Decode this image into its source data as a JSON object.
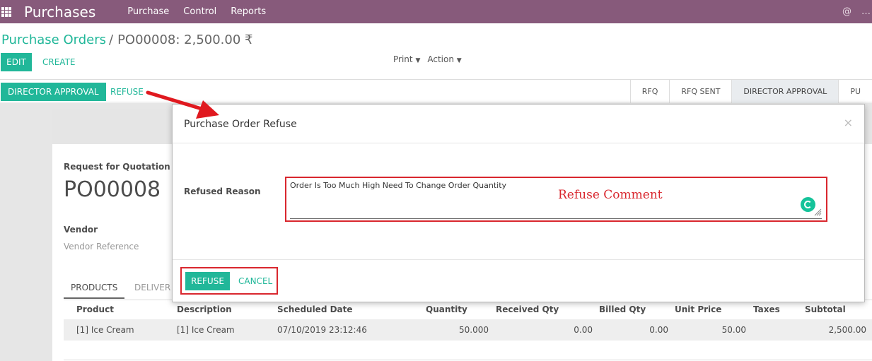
{
  "topbar": {
    "app_title": "Purchases",
    "menu": [
      "Purchase",
      "Control",
      "Reports"
    ],
    "right_icons": [
      "@",
      "…"
    ]
  },
  "breadcrumb": {
    "parent": "Purchase Orders",
    "separator": "/",
    "current": "PO00008: 2,500.00 ₹"
  },
  "control_panel": {
    "edit_label": "EDIT",
    "create_label": "CREATE",
    "print_label": "Print",
    "action_label": "Action"
  },
  "status_row": {
    "director_approval_label": "DIRECTOR APPROVAL",
    "refuse_label": "REFUSE",
    "stages": [
      "RFQ",
      "RFQ SENT",
      "DIRECTOR APPROVAL",
      "PU"
    ],
    "current_stage": "DIRECTOR APPROVAL"
  },
  "form": {
    "subtitle": "Request for Quotation",
    "po_number": "PO00008",
    "vendor_label": "Vendor",
    "vendor_reference_label": "Vendor Reference",
    "tab_products": "PRODUCTS",
    "tab_deliveries": "DELIVER"
  },
  "order_lines": {
    "headers": [
      "Product",
      "Description",
      "Scheduled Date",
      "Quantity",
      "Received Qty",
      "Billed Qty",
      "Unit Price",
      "Taxes",
      "Subtotal"
    ],
    "rows": [
      {
        "product": "[1] Ice Cream",
        "description": "[1] Ice Cream",
        "scheduled_date": "07/10/2019 23:12:46",
        "quantity": "50.000",
        "received_qty": "0.00",
        "billed_qty": "0.00",
        "unit_price": "50.00",
        "taxes": "",
        "subtotal": "2,500.00"
      }
    ]
  },
  "modal": {
    "title": "Purchase Order Refuse",
    "close_glyph": "×",
    "reason_label": "Refused Reason",
    "reason_value": "Order Is Too Much High Need To Change Order Quantity",
    "annotation": "Refuse Comment",
    "refuse_button": "REFUSE",
    "cancel_button": "CANCEL"
  },
  "colors": {
    "topbar": "#875a7b",
    "primary": "#21b799",
    "annotation_red": "#d9272e"
  }
}
